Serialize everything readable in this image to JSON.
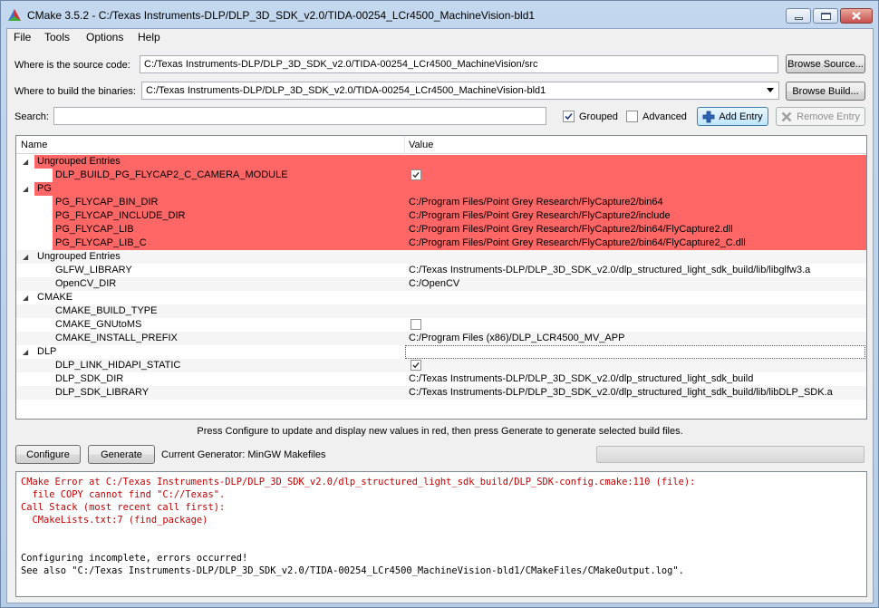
{
  "window": {
    "title": "CMake 3.5.2 - C:/Texas Instruments-DLP/DLP_3D_SDK_v2.0/TIDA-00254_LCr4500_MachineVision-bld1",
    "colors": {
      "error_highlight": "#ff6666",
      "error_text": "#c00000"
    }
  },
  "menu": [
    "File",
    "Tools",
    "Options",
    "Help"
  ],
  "source": {
    "label": "Where is the source code:",
    "value": "C:/Texas Instruments-DLP/DLP_3D_SDK_v2.0/TIDA-00254_LCr4500_MachineVision/src",
    "button": "Browse Source..."
  },
  "build": {
    "label": "Where to build the binaries:",
    "value": "C:/Texas Instruments-DLP/DLP_3D_SDK_v2.0/TIDA-00254_LCr4500_MachineVision-bld1",
    "button": "Browse Build..."
  },
  "search": {
    "label": "Search:",
    "value": "",
    "grouped_label": "Grouped",
    "grouped_checked": true,
    "advanced_label": "Advanced",
    "advanced_checked": false,
    "add_entry": "Add Entry",
    "remove_entry": "Remove Entry"
  },
  "table": {
    "headers": [
      "Name",
      "Value"
    ],
    "rows": [
      {
        "kind": "group",
        "red": true,
        "name": "Ungrouped Entries",
        "value": ""
      },
      {
        "kind": "entry",
        "red": true,
        "name": "DLP_BUILD_PG_FLYCAP2_C_CAMERA_MODULE",
        "value": "",
        "checkbox": true,
        "checked": true
      },
      {
        "kind": "group",
        "red": true,
        "name": "PG",
        "value": ""
      },
      {
        "kind": "entry",
        "red": true,
        "name": "PG_FLYCAP_BIN_DIR",
        "value": "C:/Program Files/Point Grey Research/FlyCapture2/bin64"
      },
      {
        "kind": "entry",
        "red": true,
        "name": "PG_FLYCAP_INCLUDE_DIR",
        "value": "C:/Program Files/Point Grey Research/FlyCapture2/include"
      },
      {
        "kind": "entry",
        "red": true,
        "name": "PG_FLYCAP_LIB",
        "value": "C:/Program Files/Point Grey Research/FlyCapture2/bin64/FlyCapture2.dll"
      },
      {
        "kind": "entry",
        "red": true,
        "name": "PG_FLYCAP_LIB_C",
        "value": "C:/Program Files/Point Grey Research/FlyCapture2/bin64/FlyCapture2_C.dll"
      },
      {
        "kind": "group",
        "red": false,
        "name": "Ungrouped Entries",
        "value": ""
      },
      {
        "kind": "entry",
        "red": false,
        "name": "GLFW_LIBRARY",
        "value": "C:/Texas Instruments-DLP/DLP_3D_SDK_v2.0/dlp_structured_light_sdk_build/lib/libglfw3.a"
      },
      {
        "kind": "entry",
        "red": false,
        "name": "OpenCV_DIR",
        "value": "C:/OpenCV"
      },
      {
        "kind": "group",
        "red": false,
        "name": "CMAKE",
        "value": ""
      },
      {
        "kind": "entry",
        "red": false,
        "name": "CMAKE_BUILD_TYPE",
        "value": ""
      },
      {
        "kind": "entry",
        "red": false,
        "name": "CMAKE_GNUtoMS",
        "value": "",
        "checkbox": true,
        "checked": false
      },
      {
        "kind": "entry",
        "red": false,
        "name": "CMAKE_INSTALL_PREFIX",
        "value": "C:/Program Files (x86)/DLP_LCR4500_MV_APP"
      },
      {
        "kind": "group",
        "red": false,
        "name": "DLP",
        "value": "",
        "focused": true
      },
      {
        "kind": "entry",
        "red": false,
        "name": "DLP_LINK_HIDAPI_STATIC",
        "value": "",
        "checkbox": true,
        "checked": true
      },
      {
        "kind": "entry",
        "red": false,
        "name": "DLP_SDK_DIR",
        "value": "C:/Texas Instruments-DLP/DLP_3D_SDK_v2.0/dlp_structured_light_sdk_build"
      },
      {
        "kind": "entry",
        "red": false,
        "name": "DLP_SDK_LIBRARY",
        "value": "C:/Texas Instruments-DLP/DLP_3D_SDK_v2.0/dlp_structured_light_sdk_build/lib/libDLP_SDK.a"
      }
    ]
  },
  "hint": "Press Configure to update and display new values in red, then press Generate to generate selected build files.",
  "actions": {
    "configure": "Configure",
    "generate": "Generate",
    "generator": "Current Generator: MinGW Makefiles"
  },
  "output": [
    {
      "kind": "error",
      "text": "CMake Error at C:/Texas Instruments-DLP/DLP_3D_SDK_v2.0/dlp_structured_light_sdk_build/DLP_SDK-config.cmake:110 (file):"
    },
    {
      "kind": "error",
      "text": "  file COPY cannot find \"C://Texas\"."
    },
    {
      "kind": "error",
      "text": "Call Stack (most recent call first):"
    },
    {
      "kind": "error",
      "text": "  CMakeLists.txt:7 (find_package)"
    },
    {
      "kind": "normal",
      "text": ""
    },
    {
      "kind": "normal",
      "text": ""
    },
    {
      "kind": "normal",
      "text": "Configuring incomplete, errors occurred!"
    },
    {
      "kind": "normal",
      "text": "See also \"C:/Texas Instruments-DLP/DLP_3D_SDK_v2.0/TIDA-00254_LCr4500_MachineVision-bld1/CMakeFiles/CMakeOutput.log\"."
    }
  ]
}
